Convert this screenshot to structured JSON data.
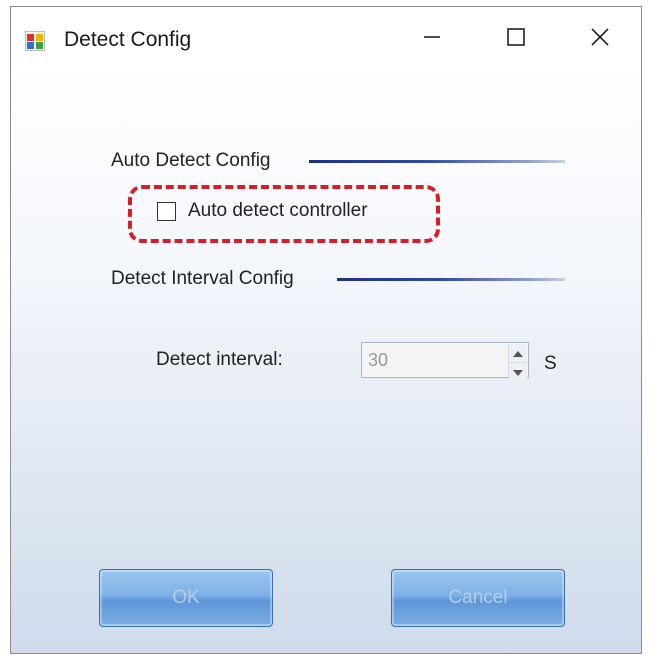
{
  "window": {
    "title": "Detect Config",
    "icon": "app-window-icon",
    "controls": [
      "minimize-icon",
      "maximize-icon",
      "close-icon"
    ]
  },
  "auto_detect": {
    "section_label": "Auto Detect Config",
    "checkbox_label": "Auto detect controller",
    "checked": false,
    "highlight_color": "#d61e2b"
  },
  "interval": {
    "section_label": "Detect Interval Config",
    "field_label": "Detect interval:",
    "value": "30",
    "unit": "S",
    "enabled": false
  },
  "buttons": {
    "ok_label": "OK",
    "cancel_label": "Cancel"
  },
  "colors": {
    "section_line": "#1f2f8a",
    "button_fill": "#7eb1e6",
    "button_text": "#b9cde4"
  }
}
